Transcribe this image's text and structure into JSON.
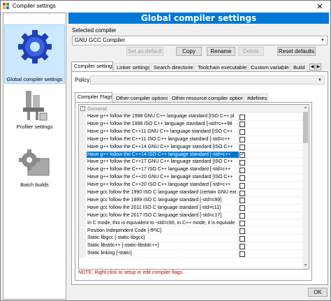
{
  "window": {
    "title": "Compiler settings",
    "close_glyph": "✕"
  },
  "sidebar": {
    "items": [
      {
        "label": "Global compiler settings",
        "icon": "gear-icon",
        "selected": true
      },
      {
        "label": "Profiler settings",
        "icon": "profiler-icon",
        "selected": false
      },
      {
        "label": "Batch builds",
        "icon": "batch-builds-icon",
        "selected": false
      }
    ]
  },
  "header": {
    "title": "Global compiler settings"
  },
  "compiler": {
    "label": "Selected compiler",
    "value": "GNU GCC Compiler",
    "buttons": {
      "set_default": "Set as default",
      "copy": "Copy",
      "rename": "Rename",
      "delete": "Delete",
      "reset_defaults": "Reset defaults"
    }
  },
  "tabs": [
    "Compiler settings",
    "Linker settings",
    "Search directories",
    "Toolchain executables",
    "Custom variables",
    "Build"
  ],
  "policy": {
    "label": "Policy:",
    "value": ""
  },
  "subtabs": [
    "Compiler Flags",
    "Other compiler options",
    "Other resource compiler options",
    "#defines"
  ],
  "flags": {
    "category": "General",
    "rows": [
      {
        "label": "Have g++ follow the 1998 GNU C++ language standard  [ISO C++ pl",
        "checked": false,
        "selected": false
      },
      {
        "label": "Have g++ follow the 1998 ISO C++ language standard  [-std=c++98",
        "checked": false,
        "selected": false
      },
      {
        "label": "Have g++ follow the C++11 GNU C++ language standard  [ISO C++",
        "checked": false,
        "selected": false
      },
      {
        "label": "Have g++ follow the C++11 ISO C++ language standard  [-std=c++",
        "checked": false,
        "selected": false
      },
      {
        "label": "Have g++ follow the C++14 GNU C++ language standard  [ISO C++",
        "checked": false,
        "selected": false
      },
      {
        "label": "Have g++ follow the C++14 ISO C++ language standard  [-std=c++",
        "checked": true,
        "selected": true
      },
      {
        "label": "Have g++ follow the C++17 GNU C++ language standard  [ISO C++",
        "checked": false,
        "selected": false
      },
      {
        "label": "Have g++ follow the C++17 ISO C++ language standard  [-std=c++",
        "checked": false,
        "selected": false
      },
      {
        "label": "Have g++ follow the C++20 GNU C++ language standard  [ISO C++",
        "checked": false,
        "selected": false
      },
      {
        "label": "Have g++ follow the C++20 ISO C++ language standard  [-std=c++",
        "checked": false,
        "selected": false
      },
      {
        "label": "Have gcc follow the 1990 ISO C language standard  (certain GNU ext",
        "checked": false,
        "selected": false
      },
      {
        "label": "Have gcc follow the 1999 ISO C language standard  [-std=c99]",
        "checked": false,
        "selected": false
      },
      {
        "label": "Have gcc follow the 2011 ISO C language standard  [-std=c11]",
        "checked": false,
        "selected": false
      },
      {
        "label": "Have gcc follow the 2017 ISO C language standard  [-std=c17]",
        "checked": false,
        "selected": false
      },
      {
        "label": "In C mode, this is equivalent to -std=c90, in C++ mode, it is equivale",
        "checked": false,
        "selected": false
      },
      {
        "label": "Position Independent Code  [-fPIC]",
        "checked": false,
        "selected": false
      },
      {
        "label": "Static libgcc  [-static-libgcc]",
        "checked": false,
        "selected": false
      },
      {
        "label": "Static libstdc++  [-static-libstdc++]",
        "checked": false,
        "selected": false
      },
      {
        "label": "Static linking  [-static]",
        "checked": false,
        "selected": false
      }
    ]
  },
  "note": "NOTE: Right-click to setup or edit compiler flags.",
  "footer": {
    "ok": "OK"
  },
  "colors": {
    "accent": "#0078d7",
    "note": "#c00000",
    "selection": "#cce8ff"
  }
}
